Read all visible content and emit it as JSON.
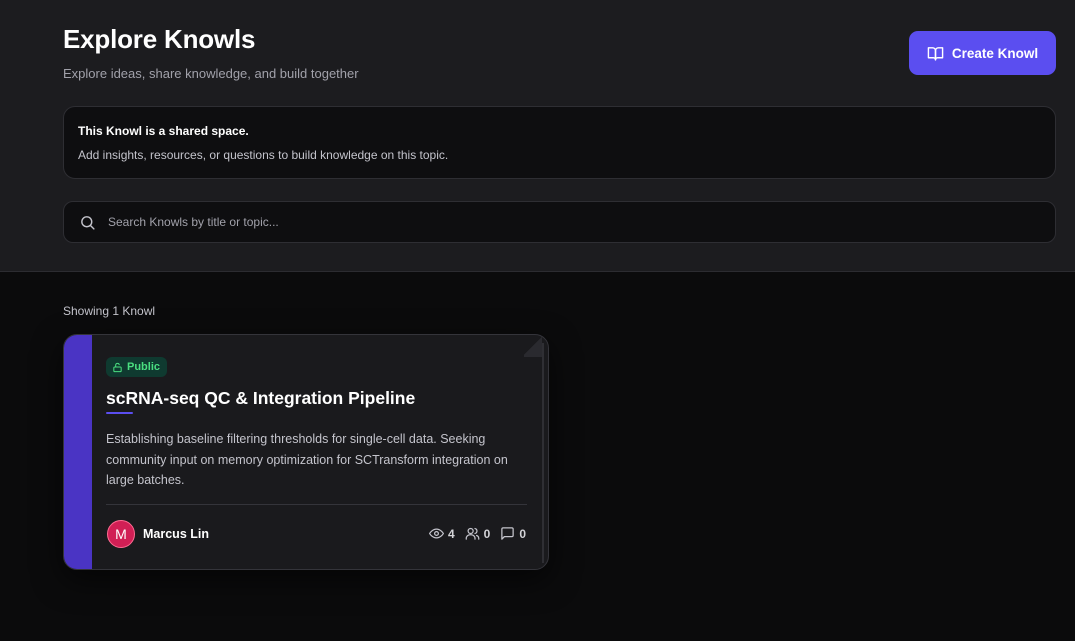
{
  "header": {
    "title": "Explore Knowls",
    "subtitle": "Explore ideas, share knowledge, and build together",
    "create_button": {
      "label": "Create Knowl",
      "icon": "book-open-icon"
    }
  },
  "info": {
    "title": "This Knowl is a shared space.",
    "text": "Add insights, resources, or questions to build knowledge on this topic."
  },
  "search": {
    "placeholder": "Search Knowls by title or topic...",
    "value": "",
    "icon": "search-icon"
  },
  "results": {
    "summary": "Showing 1 Knowl"
  },
  "cards": [
    {
      "visibility": "Public",
      "title": "scRNA-seq QC & Integration Pipeline",
      "description": "Establishing baseline filtering thresholds for single-cell data. Seeking community input on memory optimization for SCTransform integration on large batches.",
      "author": {
        "initial": "M",
        "name": "Marcus Lin"
      },
      "stats": {
        "views": "4",
        "contributors": "0",
        "comments": "0"
      }
    }
  ],
  "colors": {
    "accent": "#5b4ef0",
    "card_accent": "#4a34c4",
    "public_badge": "#4ade80",
    "avatar": "#d11f55"
  }
}
